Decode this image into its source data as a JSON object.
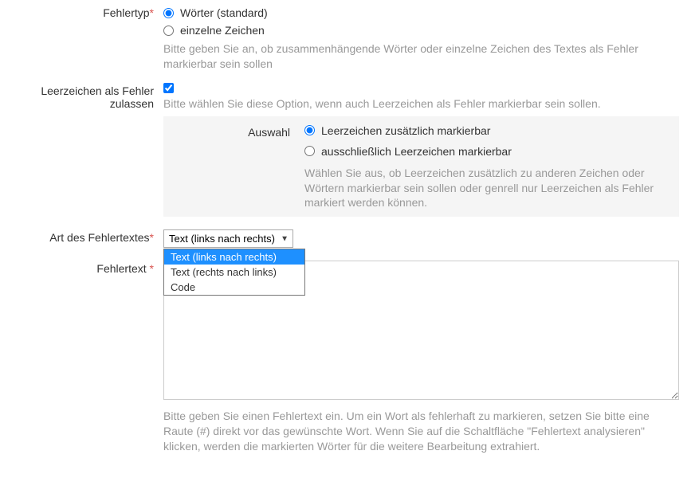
{
  "fehlertyp": {
    "label": "Fehlertyp",
    "options": {
      "words": "Wörter (standard)",
      "chars": "einzelne Zeichen"
    },
    "hint": "Bitte geben Sie an, ob zusammenhängende Wörter oder einzelne Zeichen des Textes als Fehler markierbar sein sollen"
  },
  "leerzeichen": {
    "label": "Leerzeichen als Fehler zulassen",
    "hint": "Bitte wählen Sie diese Option, wenn auch Leerzeichen als Fehler markierbar sein sollen.",
    "auswahl": {
      "label": "Auswahl",
      "options": {
        "zus": "Leerzeichen zusätzlich markierbar",
        "aus": "ausschließlich Leerzeichen markierbar"
      },
      "hint": "Wählen Sie aus, ob Leerzeichen zusätzlich zu anderen Zeichen oder Wörtern markierbar sein sollen oder genrell nur Leerzeichen als Fehler markiert werden können."
    }
  },
  "art": {
    "label": "Art des Fehlertextes",
    "selected": "Text (links nach rechts)",
    "options": [
      "Text (links nach rechts)",
      "Text (rechts nach links)",
      "Code"
    ]
  },
  "fehlertext": {
    "label": "Fehlertext",
    "value": "",
    "hint": "Bitte geben Sie einen Fehlertext ein. Um ein Wort als fehlerhaft zu markieren, setzen Sie bitte eine Raute (#) direkt vor das gewünschte Wort. Wenn Sie auf die Schaltfläche \"Fehlertext analysieren\" klicken, werden die markierten Wörter für die weitere Bearbeitung extrahiert."
  },
  "required_marker": "*"
}
